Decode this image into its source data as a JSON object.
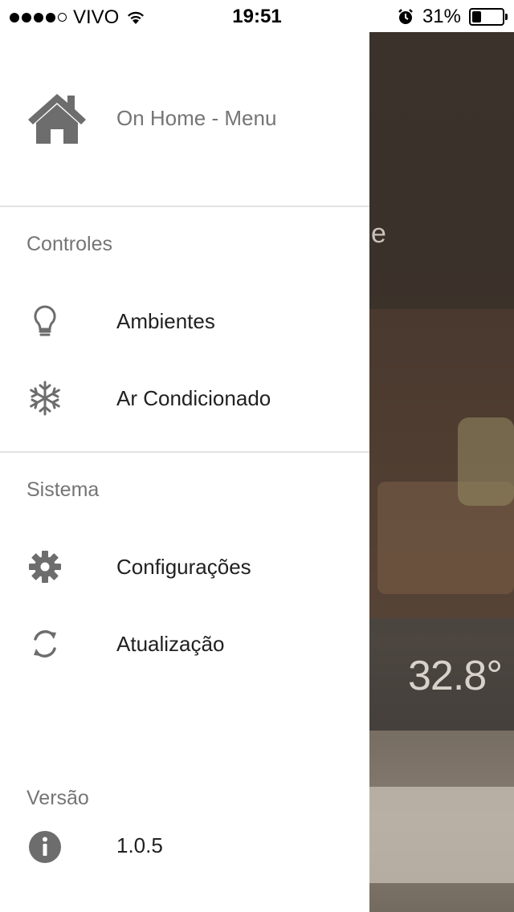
{
  "status_bar": {
    "carrier": "VIVO",
    "time": "19:51",
    "battery_percent": "31%",
    "battery_level": 0.31
  },
  "drawer": {
    "header_title": "On Home - Menu",
    "sections": {
      "controles": {
        "title": "Controles",
        "items": [
          {
            "label": "Ambientes",
            "icon": "lightbulb-icon"
          },
          {
            "label": "Ar Condicionado",
            "icon": "snowflake-icon"
          }
        ]
      },
      "sistema": {
        "title": "Sistema",
        "items": [
          {
            "label": "Configurações",
            "icon": "gear-icon"
          },
          {
            "label": "Atualização",
            "icon": "refresh-icon"
          }
        ]
      },
      "versao": {
        "title": "Versão",
        "value": "1.0.5",
        "icon": "info-icon"
      }
    }
  },
  "background": {
    "peek_text": "e",
    "temperature": "32.8°"
  },
  "colors": {
    "icon_gray": "#6d6d6d",
    "section_text": "#757575",
    "item_text": "#212121"
  }
}
